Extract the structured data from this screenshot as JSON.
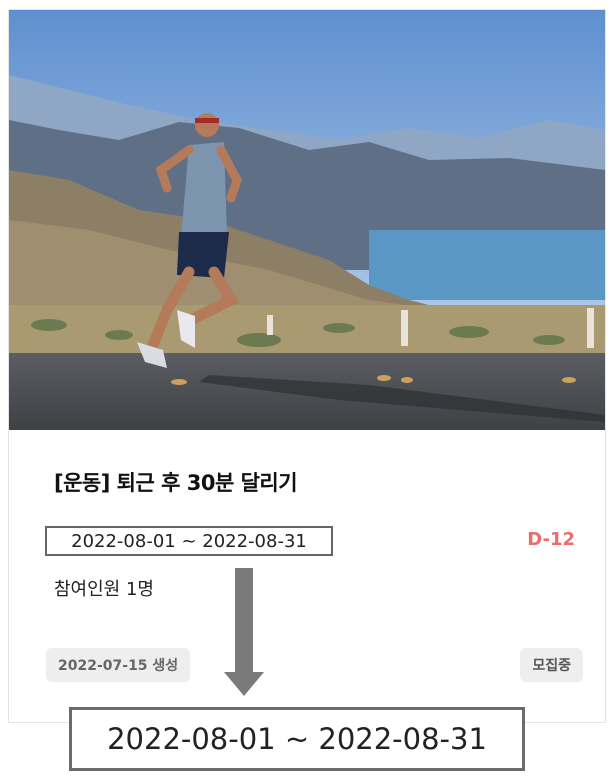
{
  "card": {
    "image_alt": "runner on road",
    "title": "[운동] 퇴근 후 30분 달리기",
    "period": "2022-08-01 ~ 2022-08-31",
    "dday": "D-12",
    "participants": "참여인원 1명",
    "created": "2022-07-15 생성",
    "status": "모집중"
  },
  "zoom": {
    "period": "2022-08-01 ~ 2022-08-31"
  },
  "colors": {
    "dday": "#ef6b6b",
    "badge_bg": "#eeeeee",
    "highlight_border": "#666666"
  },
  "icons": {
    "arrow": "arrow-down-icon"
  }
}
